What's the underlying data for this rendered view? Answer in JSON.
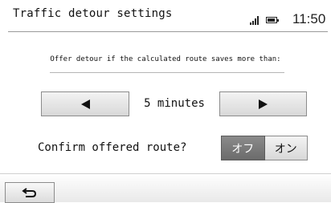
{
  "header": {
    "title": "Traffic detour settings",
    "time": "11:50",
    "signal_icon": "signal-bars-icon",
    "battery_icon": "battery-icon"
  },
  "detour": {
    "description": "Offer detour if the calculated route saves more than:",
    "value": "5 minutes",
    "prev_icon": "triangle-left-icon",
    "next_icon": "triangle-right-icon"
  },
  "confirm": {
    "label": "Confirm offered route?",
    "options": [
      "オフ",
      "オン"
    ],
    "selected": "オフ"
  },
  "footer": {
    "back_icon": "return-arrow-icon"
  },
  "colors": {
    "selected_toggle": "#6b6b6b",
    "button_face": "#e6e6e6",
    "text": "#111111"
  }
}
